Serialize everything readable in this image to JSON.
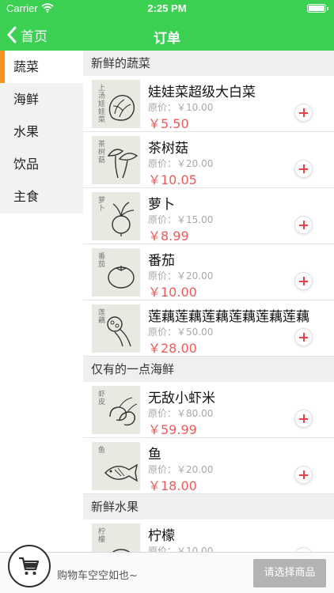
{
  "status_bar": {
    "carrier": "Carrier",
    "time": "2:25 PM"
  },
  "nav": {
    "back_label": "首页",
    "title": "订单"
  },
  "sidebar": {
    "items": [
      {
        "label": "蔬菜",
        "active": true
      },
      {
        "label": "海鲜",
        "active": false
      },
      {
        "label": "水果",
        "active": false
      },
      {
        "label": "饮品",
        "active": false
      },
      {
        "label": "主食",
        "active": false
      }
    ]
  },
  "sections": [
    {
      "title": "新鲜的蔬菜",
      "products": [
        {
          "name": "娃娃菜超级大白菜",
          "thumb_text": "上汤娃娃菜",
          "thumb_icon": "cabbage-icon",
          "original_price": "原价：￥10.00",
          "price": "￥5.50"
        },
        {
          "name": "茶树菇",
          "thumb_text": "茶树菇",
          "thumb_icon": "mushroom-icon",
          "original_price": "原价：￥20.00",
          "price": "￥10.05"
        },
        {
          "name": "萝卜",
          "thumb_text": "萝卜",
          "thumb_icon": "radish-icon",
          "original_price": "原价：￥15.00",
          "price": "￥8.99"
        },
        {
          "name": "番茄",
          "thumb_text": "番茄",
          "thumb_icon": "tomato-icon",
          "original_price": "原价：￥20.00",
          "price": "￥10.00"
        },
        {
          "name": "莲藕莲藕莲藕莲藕莲藕莲藕",
          "thumb_text": "莲藕",
          "thumb_icon": "lotus-root-icon",
          "original_price": "原价：￥50.00",
          "price": "￥28.00"
        }
      ]
    },
    {
      "title": "仅有的一点海鲜",
      "products": [
        {
          "name": "无敌小虾米",
          "thumb_text": "虾皮",
          "thumb_icon": "shrimp-icon",
          "original_price": "原价：￥80.00",
          "price": "￥59.99"
        },
        {
          "name": "鱼",
          "thumb_text": "鱼",
          "thumb_icon": "fish-icon",
          "original_price": "原价：￥20.00",
          "price": "￥18.00"
        }
      ]
    },
    {
      "title": "新鲜水果",
      "products": [
        {
          "name": "柠檬",
          "thumb_text": "柠檬",
          "thumb_icon": "lemon-icon",
          "original_price": "原价：￥10.00",
          "price": ""
        }
      ]
    }
  ],
  "cart": {
    "empty_text": "购物车空空如也~",
    "checkout_label": "请选择商品"
  },
  "colors": {
    "nav_green": "#3bd052",
    "active_orange": "#f7931e",
    "price_red": "#ef5a5a",
    "add_red": "#e8424a",
    "checkout_gray": "#b3b3b3"
  }
}
